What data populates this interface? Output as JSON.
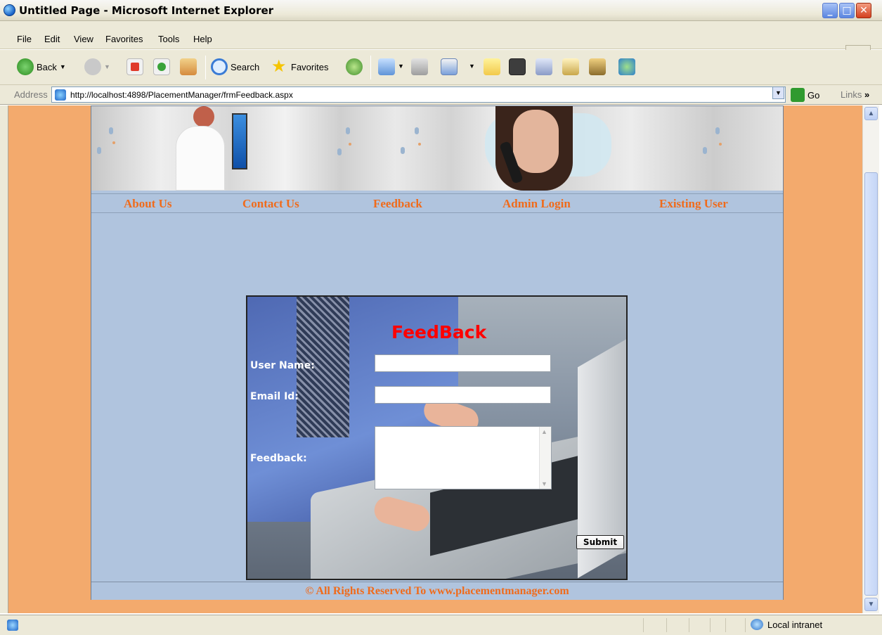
{
  "window": {
    "title": "Untitled Page - Microsoft Internet Explorer"
  },
  "menu": [
    "File",
    "Edit",
    "View",
    "Favorites",
    "Tools",
    "Help"
  ],
  "toolbar": {
    "back_label": "Back",
    "search_label": "Search",
    "favorites_label": "Favorites"
  },
  "address": {
    "label": "Address",
    "url": "http://localhost:4898/PlacementManager/frmFeedback.aspx",
    "go_label": "Go",
    "links_label": "Links"
  },
  "nav": {
    "about": "About Us",
    "contact": "Contact Us",
    "feedback": "Feedback",
    "admin": "Admin Login",
    "existing": "Existing User"
  },
  "form": {
    "title": "FeedBack",
    "username_label": "User Name:",
    "username_value": "",
    "email_label": "Email Id:",
    "email_value": "",
    "feedback_label": "Feedback:",
    "feedback_value": "",
    "submit_label": "Submit"
  },
  "footer": {
    "text": "© All Rights Reserved To www.placementmanager.com"
  },
  "status": {
    "zone": "Local intranet"
  },
  "colors": {
    "page_bg": "#f3aa6d",
    "content_bg": "#b0c4de",
    "nav_link": "#f06b1b",
    "form_title": "#ff0000"
  }
}
